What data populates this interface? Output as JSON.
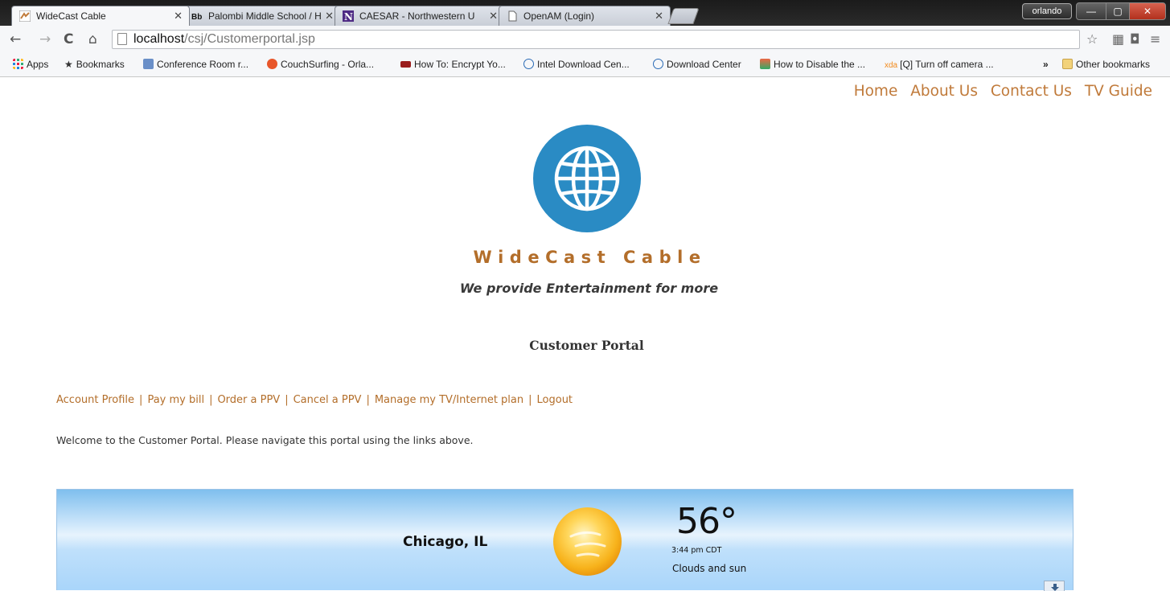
{
  "browser": {
    "tabs": [
      {
        "title": "WideCast Cable",
        "active": true,
        "icon": "widecast-favicon"
      },
      {
        "title": "Palombi Middle School / H",
        "active": false,
        "icon": "blackboard-favicon"
      },
      {
        "title": "CAESAR - Northwestern U",
        "active": false,
        "icon": "northwestern-favicon"
      },
      {
        "title": "OpenAM (Login)",
        "active": false,
        "icon": "page-favicon"
      }
    ],
    "user": "orlando",
    "url_host": "localhost",
    "url_path": "/csj/Customerportal.jsp",
    "bookmarks": [
      {
        "label": "Apps",
        "icon": "apps-icon"
      },
      {
        "label": "Bookmarks",
        "icon": "star-icon"
      },
      {
        "label": "Conference Room r...",
        "icon": "conference-icon"
      },
      {
        "label": "CouchSurfing - Orla...",
        "icon": "couchsurfing-icon"
      },
      {
        "label": "How To: Encrypt Yo...",
        "icon": "mpc-icon"
      },
      {
        "label": "Intel Download Cen...",
        "icon": "intel-icon"
      },
      {
        "label": "Download Center",
        "icon": "intel-icon"
      },
      {
        "label": "How to Disable the ...",
        "icon": "figure-icon"
      },
      {
        "label": "[Q] Turn off camera ...",
        "icon": "xda-icon"
      }
    ],
    "overflow": "»",
    "other_bookmarks": "Other bookmarks"
  },
  "nav": {
    "home": "Home",
    "about": "About Us",
    "contact": "Contact Us",
    "tvguide": "TV Guide"
  },
  "brand": {
    "name": "WideCast Cable",
    "tagline": "We provide Entertainment for more",
    "logo_color": "#2a8bc4"
  },
  "portal": {
    "title": "Customer Portal",
    "links": [
      "Account Profile",
      "Pay my bill",
      "Order a PPV",
      "Cancel a PPV",
      "Manage my TV/Internet plan",
      "Logout"
    ],
    "separator": "|",
    "welcome": "Welcome to the Customer Portal. Please navigate this portal using the links above."
  },
  "weather": {
    "city": "Chicago, IL",
    "temperature": "56°",
    "time": "3:44 pm CDT",
    "condition": "Clouds and sun",
    "icon": "sun-cloud-icon"
  },
  "colors": {
    "link": "#c07a3a",
    "brand": "#b36e2a"
  }
}
